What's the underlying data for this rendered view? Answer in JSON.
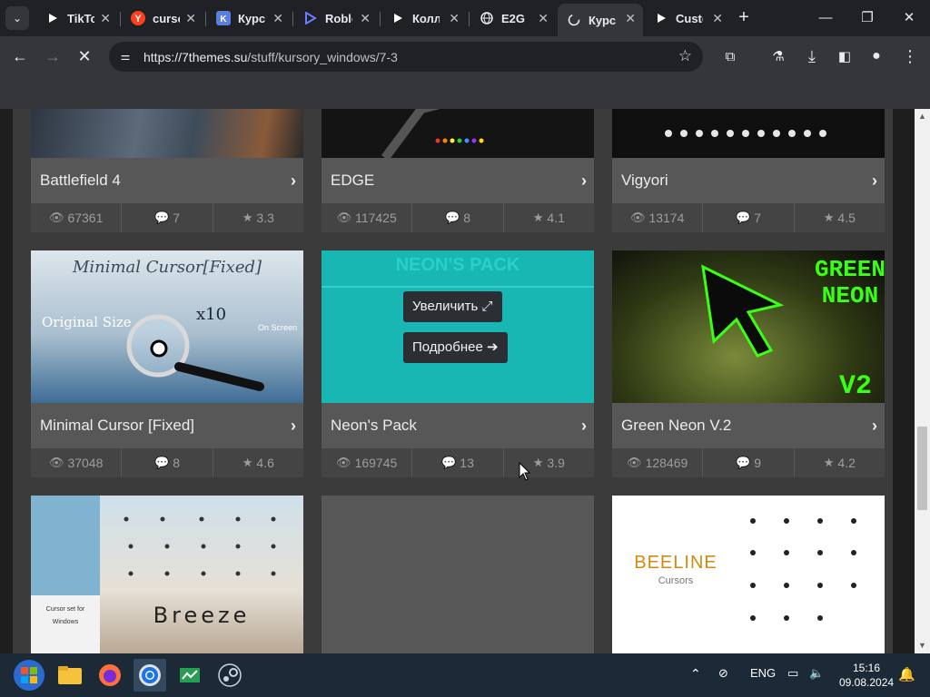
{
  "browser": {
    "tabs": [
      {
        "title": "TikTok",
        "icon": "tiktok-icon"
      },
      {
        "title": "cursors",
        "icon": "yandex-icon"
      },
      {
        "title": "Курсоры",
        "icon": "vk-icon"
      },
      {
        "title": "Roblox",
        "icon": "robux-icon"
      },
      {
        "title": "Коллекция",
        "icon": "play-icon"
      },
      {
        "title": "E2G",
        "icon": "globe-icon"
      },
      {
        "title": "Курсоры",
        "icon": "loading-icon"
      },
      {
        "title": "Custom",
        "icon": "play-icon"
      }
    ],
    "url_host": "https://7themes.su",
    "url_path": "/stuff/kursory_windows/7-3"
  },
  "cards": [
    {
      "title": "Battlefield 4",
      "views": "67361",
      "comments": "7",
      "rating": "3.3"
    },
    {
      "title": "EDGE",
      "views": "117425",
      "comments": "8",
      "rating": "4.1"
    },
    {
      "title": "Vigyori",
      "views": "13174",
      "comments": "7",
      "rating": "4.5"
    },
    {
      "title": "Minimal Cursor [Fixed]",
      "views": "37048",
      "comments": "8",
      "rating": "4.6",
      "img_title": "Minimal Cursor[Fixed]",
      "img_orig": "Original Size",
      "img_x10": "x10",
      "img_onscreen": "On Screen"
    },
    {
      "title": "Neon's Pack",
      "views": "169745",
      "comments": "13",
      "rating": "3.9",
      "img_title": "NEON'S PACK"
    },
    {
      "title": "Green Neon V.2",
      "views": "128469",
      "comments": "9",
      "rating": "4.2",
      "img_line1": "GREEN",
      "img_line2": "NEON",
      "img_v": "V2"
    },
    {
      "title": "",
      "img_word": "Breeze",
      "img_caption1": "Cursor set for",
      "img_caption2": "Windows"
    },
    {
      "title": ""
    },
    {
      "title": "",
      "img_word": "BEELINE",
      "img_sub": "Cursors"
    }
  ],
  "overlay": {
    "zoom_label": "Увеличить",
    "details_label": "Подробнее"
  },
  "tray": {
    "language": "ENG",
    "time": "15:16",
    "date": "09.08.2024"
  },
  "colors": {
    "accent_neon": "#19b7b3",
    "green_neon": "#39ff14",
    "page_bg": "#3b3b3b"
  }
}
